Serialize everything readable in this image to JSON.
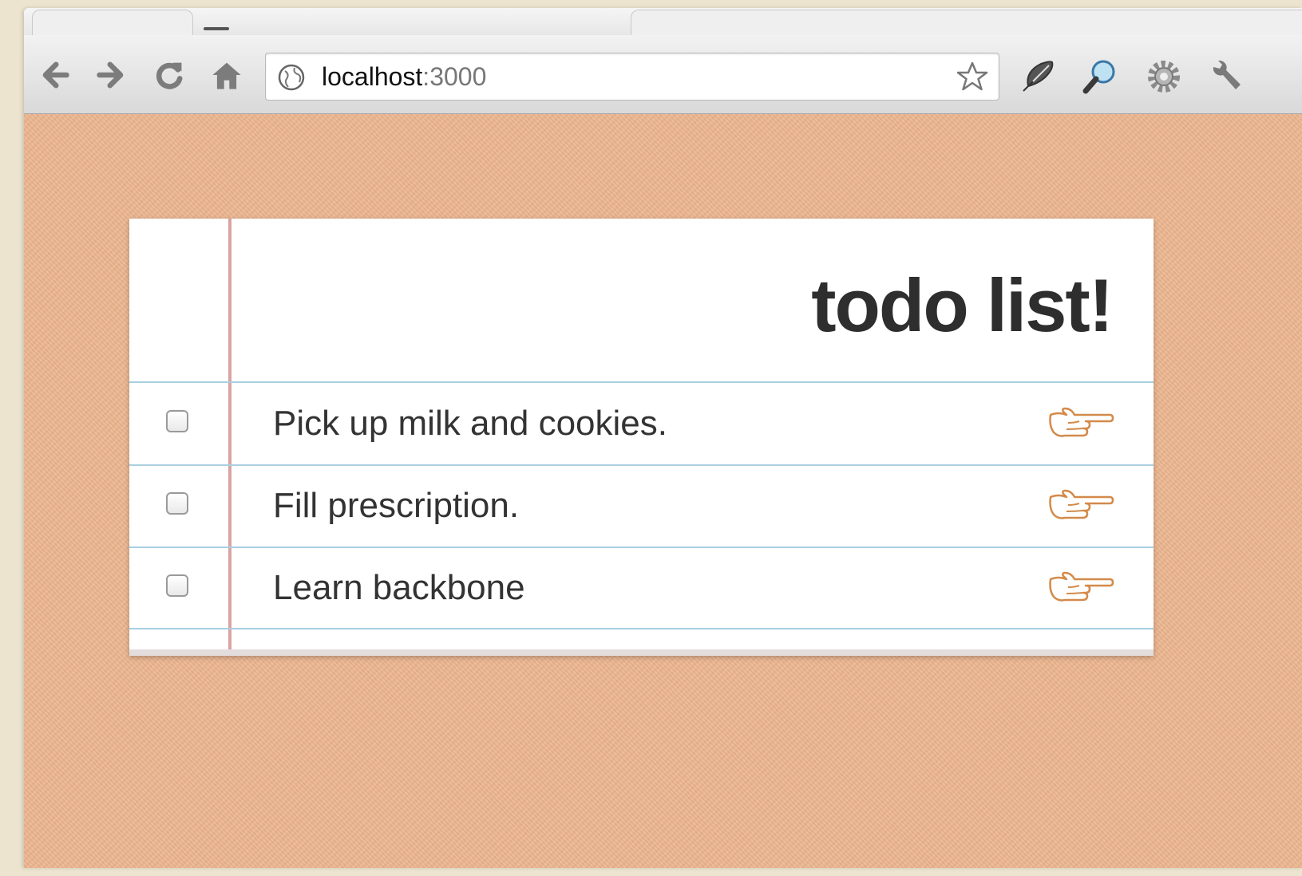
{
  "browser": {
    "url_host": "localhost",
    "url_port": ":3000",
    "icons": {
      "back": "arrow-left-icon",
      "forward": "arrow-right-icon",
      "reload": "reload-icon",
      "home": "home-icon",
      "site": "globe-icon",
      "bookmark": "star-icon",
      "ext1": "feather-pen-icon",
      "ext2": "magnifier-icon",
      "ext3": "gear-icon",
      "menu": "wrench-icon"
    }
  },
  "todo": {
    "title": "todo list!",
    "items": [
      {
        "label": "Pick up milk and cookies.",
        "done": false,
        "icon": "pointing-hand-icon"
      },
      {
        "label": "Fill prescription.",
        "done": false,
        "icon": "pointing-hand-icon"
      },
      {
        "label": "Learn backbone",
        "done": false,
        "icon": "pointing-hand-icon"
      }
    ]
  },
  "colors": {
    "page_background": "#ecb58e",
    "margin_line": "#d9a3a3",
    "rule_line": "#a9cfe0",
    "title_text": "#2e2e2e",
    "hand_icon": "#d38a49"
  }
}
